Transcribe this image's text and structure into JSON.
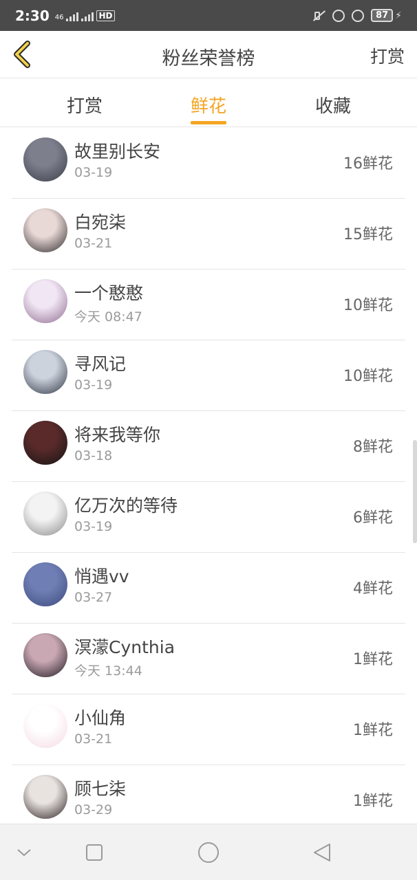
{
  "status_bar": {
    "time": "2:30",
    "network_left": "46",
    "hd_label": "HD",
    "battery": "87"
  },
  "header": {
    "title": "粉丝荣誉榜",
    "action_label": "打赏",
    "back_icon": "chevron-left-icon"
  },
  "tabs": [
    {
      "label": "打赏",
      "active": false
    },
    {
      "label": "鲜花",
      "active": true
    },
    {
      "label": "收藏",
      "active": false
    }
  ],
  "accent_color": "#f3a625",
  "list": [
    {
      "name": "故里别长安",
      "date": "03-19",
      "amount": "16鲜花",
      "avatar_colors": [
        "#7d7f8d",
        "#3b3d48"
      ]
    },
    {
      "name": "白宛柒",
      "date": "03-21",
      "amount": "15鲜花",
      "avatar_colors": [
        "#e9d9d6",
        "#2e2a2c"
      ]
    },
    {
      "name": "一个憨憨",
      "date": "今天 08:47",
      "amount": "10鲜花",
      "avatar_colors": [
        "#f1e6f4",
        "#8f6c8f"
      ]
    },
    {
      "name": "寻风记",
      "date": "03-19",
      "amount": "10鲜花",
      "avatar_colors": [
        "#cdd3dd",
        "#2f3542"
      ]
    },
    {
      "name": "将来我等你",
      "date": "03-18",
      "amount": "8鲜花",
      "avatar_colors": [
        "#5a2a2a",
        "#141414"
      ]
    },
    {
      "name": "亿万次的等待",
      "date": "03-19",
      "amount": "6鲜花",
      "avatar_colors": [
        "#f3f3f3",
        "#8a8a8a"
      ]
    },
    {
      "name": "悄遇vv",
      "date": "03-27",
      "amount": "4鲜花",
      "avatar_colors": [
        "#6f7fb5",
        "#3c4a7c"
      ]
    },
    {
      "name": "溟濛Cynthia",
      "date": "今天 13:44",
      "amount": "1鲜花",
      "avatar_colors": [
        "#c9a8b3",
        "#1f1a22"
      ]
    },
    {
      "name": "小仙角",
      "date": "03-21",
      "amount": "1鲜花",
      "avatar_colors": [
        "#ffffff",
        "#f4d9e4"
      ]
    },
    {
      "name": "顾七柒",
      "date": "03-29",
      "amount": "1鲜花",
      "avatar_colors": [
        "#e9e3e0",
        "#2b2222"
      ]
    }
  ],
  "navbar": {
    "icons": [
      "chevron-down-icon",
      "square-icon",
      "circle-icon",
      "triangle-back-icon"
    ]
  }
}
